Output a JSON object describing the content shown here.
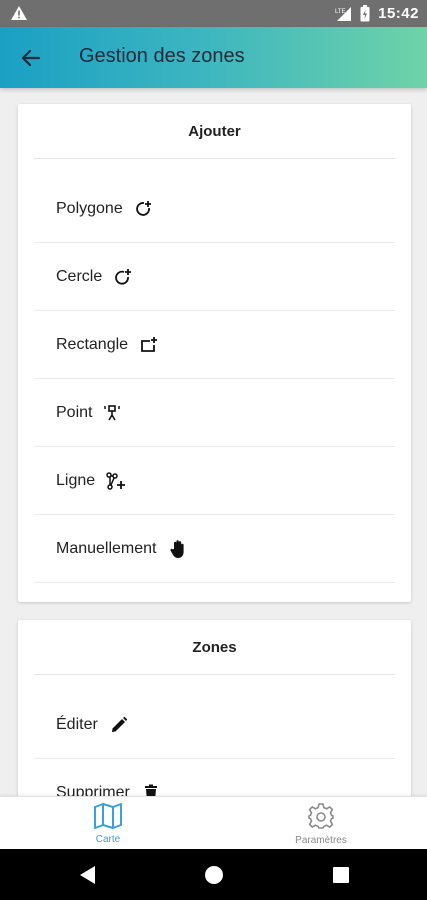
{
  "status_bar": {
    "time": "15:42"
  },
  "app_bar": {
    "title": "Gestion des zones"
  },
  "add_card": {
    "title": "Ajouter",
    "items": [
      {
        "label": "Polygone",
        "icon": "polygon-add-icon"
      },
      {
        "label": "Cercle",
        "icon": "circle-add-icon"
      },
      {
        "label": "Rectangle",
        "icon": "rectangle-add-icon"
      },
      {
        "label": "Point",
        "icon": "point-add-icon"
      },
      {
        "label": "Ligne",
        "icon": "line-add-icon"
      },
      {
        "label": "Manuellement",
        "icon": "hand-icon"
      }
    ]
  },
  "zones_card": {
    "title": "Zones",
    "items": [
      {
        "label": "Éditer",
        "icon": "pencil-icon"
      },
      {
        "label": "Supprimer",
        "icon": "trash-icon"
      }
    ]
  },
  "bottom_nav": {
    "items": [
      {
        "label": "Carte",
        "icon": "map-icon",
        "active": true
      },
      {
        "label": "Paramètres",
        "icon": "gear-icon",
        "active": false
      }
    ]
  },
  "colors": {
    "accent": "#3aa0d8",
    "appbar_start": "#1aa0c4",
    "appbar_end": "#6fd3a8",
    "status_bar": "#6f6f6f"
  }
}
